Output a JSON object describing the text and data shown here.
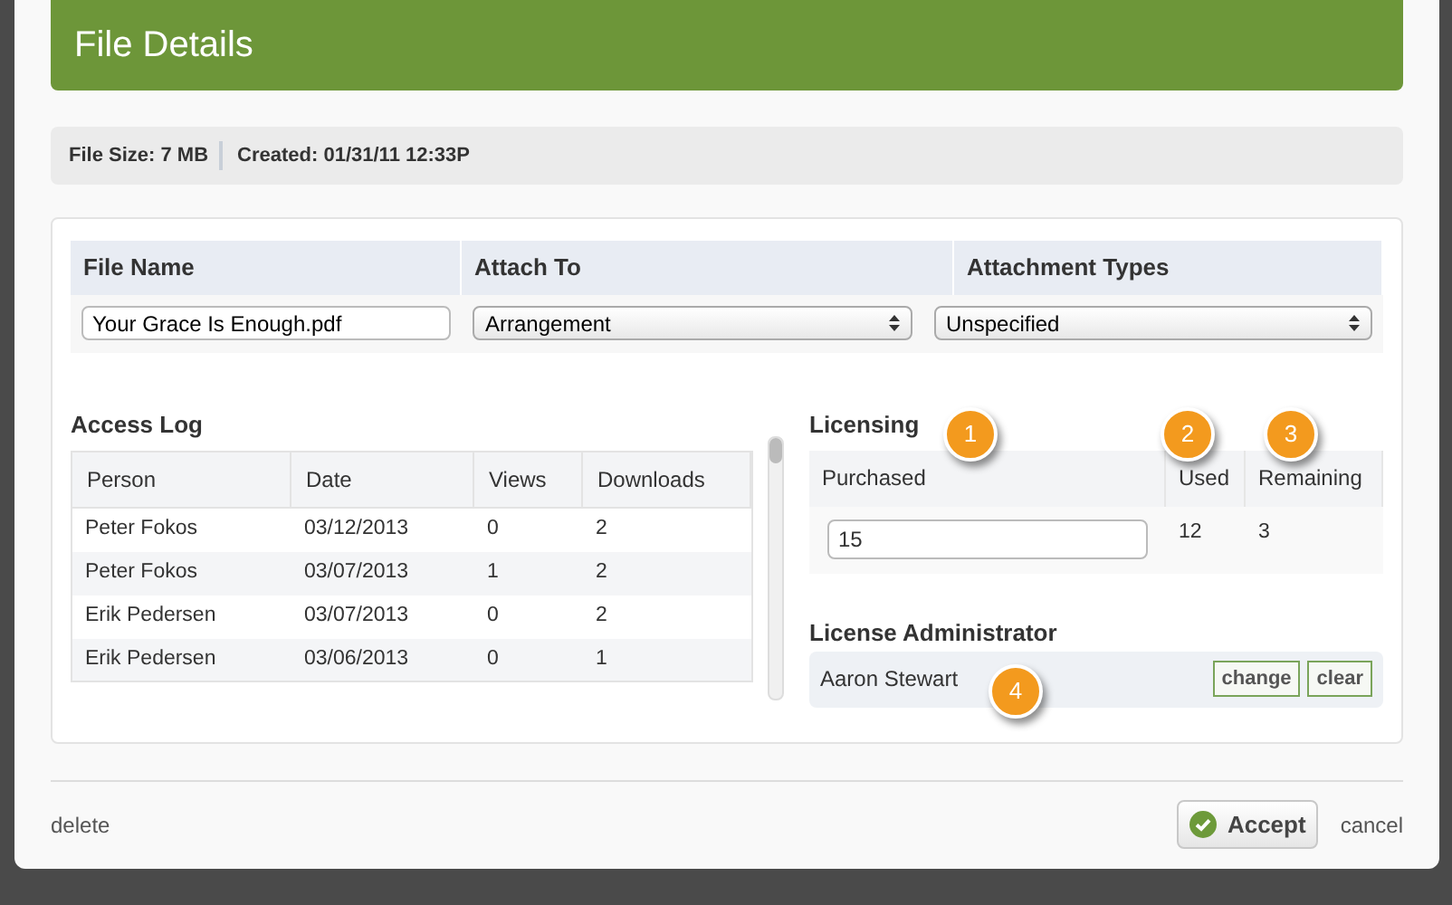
{
  "dialog": {
    "title": "File Details"
  },
  "info": [
    {
      "label": "File Size:",
      "value": "7 MB"
    },
    {
      "label": "Created:",
      "value": "01/31/11 12:33P"
    }
  ],
  "file_table": {
    "columns": [
      "File Name",
      "Attach To",
      "Attachment Types"
    ],
    "file_name": "Your Grace Is Enough.pdf",
    "attach_to": "Arrangement",
    "attachment_type": "Unspecified"
  },
  "access_log": {
    "title": "Access Log",
    "columns": [
      "Person",
      "Date",
      "Views",
      "Downloads"
    ],
    "rows": [
      [
        "Peter Fokos",
        "03/12/2013",
        "0",
        "2"
      ],
      [
        "Peter Fokos",
        "03/07/2013",
        "1",
        "2"
      ],
      [
        "Erik Pedersen",
        "03/07/2013",
        "0",
        "2"
      ],
      [
        "Erik Pedersen",
        "03/06/2013",
        "0",
        "1"
      ]
    ]
  },
  "licensing": {
    "title": "Licensing",
    "columns": [
      "Purchased",
      "Used",
      "Remaining"
    ],
    "purchased": "15",
    "used": "12",
    "remaining": "3"
  },
  "license_admin": {
    "title": "License Administrator",
    "name": "Aaron Stewart",
    "buttons": [
      "change",
      "clear"
    ]
  },
  "callouts": [
    "1",
    "2",
    "3",
    "4"
  ],
  "footer": {
    "delete": "delete",
    "accept": "Accept",
    "cancel": "cancel"
  }
}
